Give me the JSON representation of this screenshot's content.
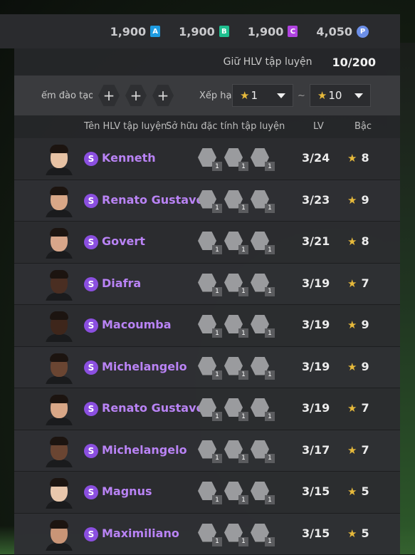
{
  "currencies": [
    {
      "value": "1,900",
      "icon": "A",
      "icon_name": "a-currency-icon",
      "color": "#1e9be0"
    },
    {
      "value": "1,900",
      "icon": "B",
      "icon_name": "b-currency-icon",
      "color": "#1fbf8f"
    },
    {
      "value": "1,900",
      "icon": "C",
      "icon_name": "c-currency-icon",
      "color": "#b043e0"
    },
    {
      "value": "4,050",
      "icon": "P",
      "icon_name": "p-coin-icon",
      "color": "#6c8fe8"
    }
  ],
  "coach_count": {
    "label": "Giữ HLV tập luyện",
    "value": "10/200"
  },
  "filters": {
    "training_label": "ểm đào tạo",
    "slot_symbol": "+",
    "tier_label": "Xếp hạ",
    "tier_from": "1",
    "tier_to": "10",
    "range_separator": "~",
    "star": "★"
  },
  "columns": {
    "name": "Tên HLV tập luyện",
    "traits": "Sở hữu đặc tính tập luyện",
    "lv": "LV",
    "grade": "Bậc"
  },
  "badge_letter": "S",
  "coaches": [
    {
      "name": "Kenneth",
      "lv": "3/24",
      "grade": "8",
      "skin": "#e7c2a4",
      "traits": [
        "1",
        "1",
        "1"
      ]
    },
    {
      "name": "Renato Gustavo",
      "lv": "3/23",
      "grade": "9",
      "skin": "#d9a787",
      "traits": [
        "1",
        "1",
        "1"
      ]
    },
    {
      "name": "Govert",
      "lv": "3/21",
      "grade": "8",
      "skin": "#d8a68a",
      "traits": [
        "1",
        "1",
        "1"
      ]
    },
    {
      "name": "Diafra",
      "lv": "3/19",
      "grade": "7",
      "skin": "#4a2e22",
      "traits": [
        "1",
        "1",
        "1"
      ]
    },
    {
      "name": "Macoumba",
      "lv": "3/19",
      "grade": "9",
      "skin": "#3e261b",
      "traits": [
        "1",
        "1",
        "1"
      ]
    },
    {
      "name": "Michelangelo",
      "lv": "3/19",
      "grade": "9",
      "skin": "#6a4532",
      "traits": [
        "1",
        "1",
        "1"
      ]
    },
    {
      "name": "Renato Gustavo",
      "lv": "3/19",
      "grade": "7",
      "skin": "#d9a787",
      "traits": [
        "1",
        "1",
        "1"
      ]
    },
    {
      "name": "Michelangelo",
      "lv": "3/17",
      "grade": "7",
      "skin": "#6a4532",
      "traits": [
        "1",
        "1",
        "1"
      ]
    },
    {
      "name": "Magnus",
      "lv": "3/15",
      "grade": "5",
      "skin": "#e9c7ac",
      "traits": [
        "1",
        "1",
        "1"
      ]
    },
    {
      "name": "Maximiliano",
      "lv": "3/15",
      "grade": "5",
      "skin": "#c99577",
      "traits": [
        "1",
        "1",
        "1"
      ]
    }
  ]
}
